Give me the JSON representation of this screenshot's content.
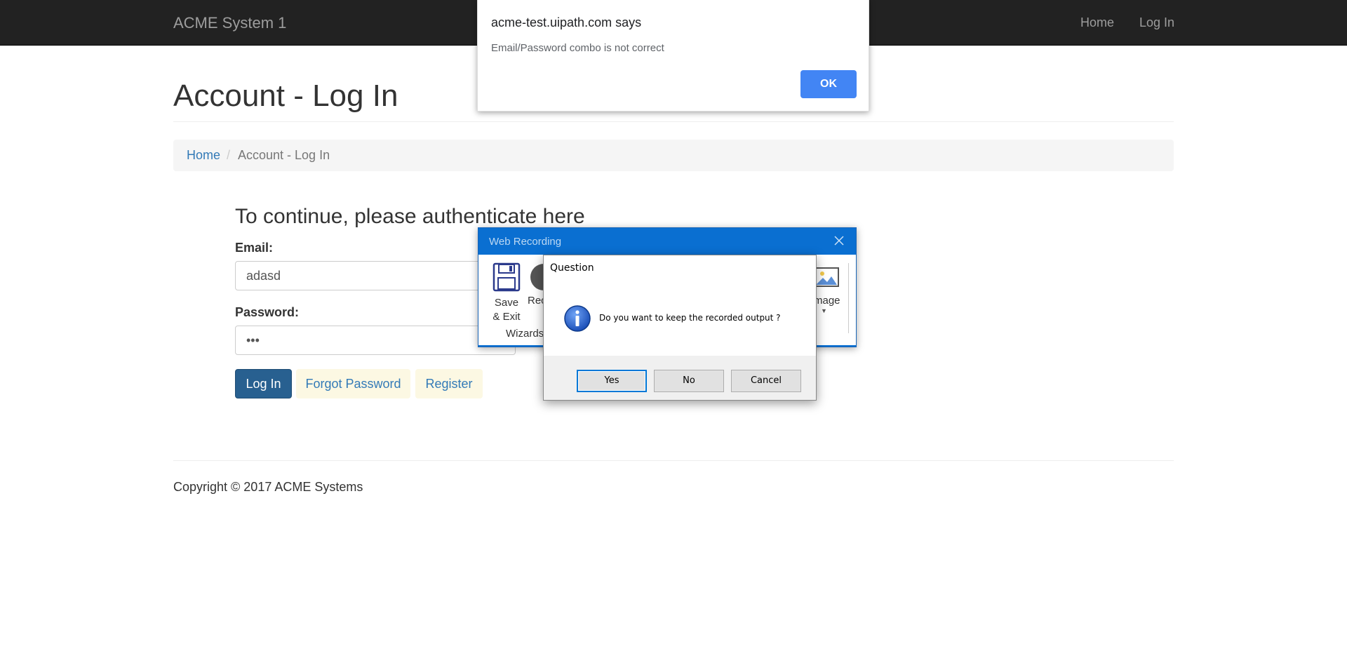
{
  "navbar": {
    "brand": "ACME System 1",
    "links": [
      "Home",
      "Log In"
    ]
  },
  "page": {
    "title": "Account - Log In",
    "breadcrumb": {
      "home": "Home",
      "separator": "/",
      "current": "Account - Log In"
    },
    "subtitle": "To continue, please authenticate here",
    "email_label": "Email:",
    "email_value": "adasd",
    "password_label": "Password:",
    "password_value": "•••",
    "login_button": "Log In",
    "forgot_button": "Forgot Password",
    "register_button": "Register",
    "copyright": "Copyright © 2017 ACME Systems"
  },
  "alert": {
    "title": "acme-test.uipath.com says",
    "message": "Email/Password combo is not correct",
    "ok_label": "OK"
  },
  "web_recording": {
    "title": "Web Recording",
    "save_label_1": "Save",
    "save_label_2": "& Exit",
    "record_label": "Rec",
    "image_label": "mage",
    "group_label": "Wizards"
  },
  "question_dialog": {
    "title": "Question",
    "message": "Do you want to keep the recorded output ?",
    "buttons": [
      "Yes",
      "No",
      "Cancel"
    ],
    "icon": "info-icon"
  },
  "colors": {
    "navbar_bg": "#222222",
    "primary_button": "#286090",
    "link": "#337ab7",
    "alert_ok": "#4285f4",
    "recorder_titlebar": "#0a6fd1"
  }
}
